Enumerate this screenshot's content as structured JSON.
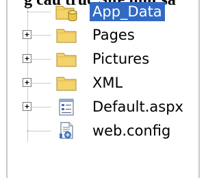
{
  "header": {
    "title": "g cấu trúc Site như sa"
  },
  "tree": {
    "items": [
      {
        "label": "App_Data",
        "icon": "database-folder-icon",
        "expandable": false,
        "selected": true
      },
      {
        "label": "Pages",
        "icon": "folder-icon",
        "expandable": true,
        "selected": false
      },
      {
        "label": "Pictures",
        "icon": "folder-icon",
        "expandable": true,
        "selected": false
      },
      {
        "label": "XML",
        "icon": "folder-icon",
        "expandable": true,
        "selected": false
      },
      {
        "label": "Default.aspx",
        "icon": "aspx-file-icon",
        "expandable": true,
        "selected": false
      },
      {
        "label": "web.config",
        "icon": "config-file-icon",
        "expandable": false,
        "selected": false
      }
    ]
  },
  "colors": {
    "selection": "#316ac5",
    "folder": "#f4d46a",
    "tree_line": "#9a9a9a"
  }
}
